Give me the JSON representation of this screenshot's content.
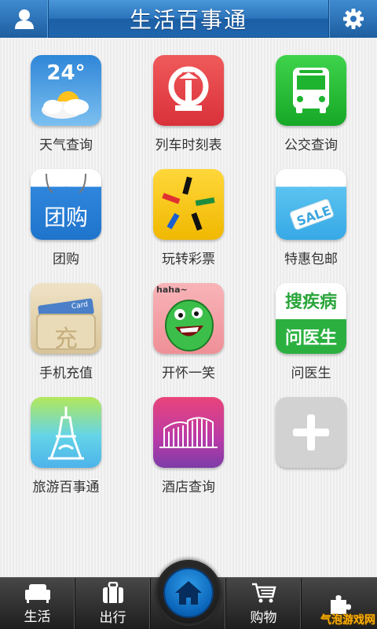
{
  "header": {
    "title": "生活百事通",
    "user_icon": "user-icon",
    "settings_icon": "gear-icon"
  },
  "tiles": [
    {
      "label": "天气查询",
      "icon": "weather-icon",
      "temp": "24°"
    },
    {
      "label": "列车时刻表",
      "icon": "train-icon"
    },
    {
      "label": "公交查询",
      "icon": "bus-icon"
    },
    {
      "label": "团购",
      "icon": "group-buy-icon",
      "icon_text": "团购"
    },
    {
      "label": "玩转彩票",
      "icon": "lottery-icon"
    },
    {
      "label": "特惠包邮",
      "icon": "sale-icon",
      "icon_text": "SALE"
    },
    {
      "label": "手机充值",
      "icon": "recharge-icon",
      "icon_text": "充",
      "card_text": "Card"
    },
    {
      "label": "开怀一笑",
      "icon": "haha-icon",
      "icon_text": "haha~"
    },
    {
      "label": "问医生",
      "icon": "doctor-icon",
      "icon_top": "搜疾病",
      "icon_bottom": "问医生"
    },
    {
      "label": "旅游百事通",
      "icon": "travel-icon"
    },
    {
      "label": "酒店查询",
      "icon": "hotel-icon"
    },
    {
      "label": "",
      "icon": "add-icon"
    }
  ],
  "nav": {
    "items": [
      {
        "label": "生活",
        "icon": "sofa-icon"
      },
      {
        "label": "出行",
        "icon": "luggage-icon"
      },
      {
        "label": "",
        "icon": "home-icon"
      },
      {
        "label": "购物",
        "icon": "cart-icon"
      },
      {
        "label": "",
        "icon": "puzzle-icon"
      }
    ]
  },
  "watermark": "气泡游戏网",
  "colors": {
    "header_blue": "#2a73bc",
    "nav_dark": "#2a2a2a",
    "home_blue": "#1a7fd4"
  }
}
